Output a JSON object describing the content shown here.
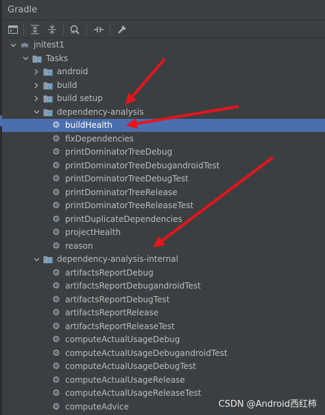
{
  "panel": {
    "title": "Gradle"
  },
  "toolbar": {
    "icons": [
      "run-tasks-icon",
      "expand-all-icon",
      "collapse-all-icon",
      "analyze-dependencies-icon",
      "toggle-offline-icon",
      "settings-wrench-icon"
    ]
  },
  "tree": {
    "rows": [
      {
        "label": "jnitest1"
      },
      {
        "label": "Tasks"
      },
      {
        "label": "android"
      },
      {
        "label": "build"
      },
      {
        "label": "build setup"
      },
      {
        "label": "dependency-analysis"
      },
      {
        "label": "buildHealth"
      },
      {
        "label": "fixDependencies"
      },
      {
        "label": "printDominatorTreeDebug"
      },
      {
        "label": "printDominatorTreeDebugandroidTest"
      },
      {
        "label": "printDominatorTreeDebugTest"
      },
      {
        "label": "printDominatorTreeRelease"
      },
      {
        "label": "printDominatorTreeReleaseTest"
      },
      {
        "label": "printDuplicateDependencies"
      },
      {
        "label": "projectHealth"
      },
      {
        "label": "reason"
      },
      {
        "label": "dependency-analysis-internal"
      },
      {
        "label": "artifactsReportDebug"
      },
      {
        "label": "artifactsReportDebugandroidTest"
      },
      {
        "label": "artifactsReportDebugTest"
      },
      {
        "label": "artifactsReportRelease"
      },
      {
        "label": "artifactsReportReleaseTest"
      },
      {
        "label": "computeActualUsageDebug"
      },
      {
        "label": "computeActualUsageDebugandroidTest"
      },
      {
        "label": "computeActualUsageDebugTest"
      },
      {
        "label": "computeActualUsageRelease"
      },
      {
        "label": "computeActualUsageReleaseTest"
      },
      {
        "label": "computeAdvice"
      }
    ]
  },
  "watermark": "CSDN @Android西红柿",
  "colors": {
    "background": "#3c3f41",
    "selection": "#4b6eaf",
    "annotation_arrow": "#e8141a"
  }
}
